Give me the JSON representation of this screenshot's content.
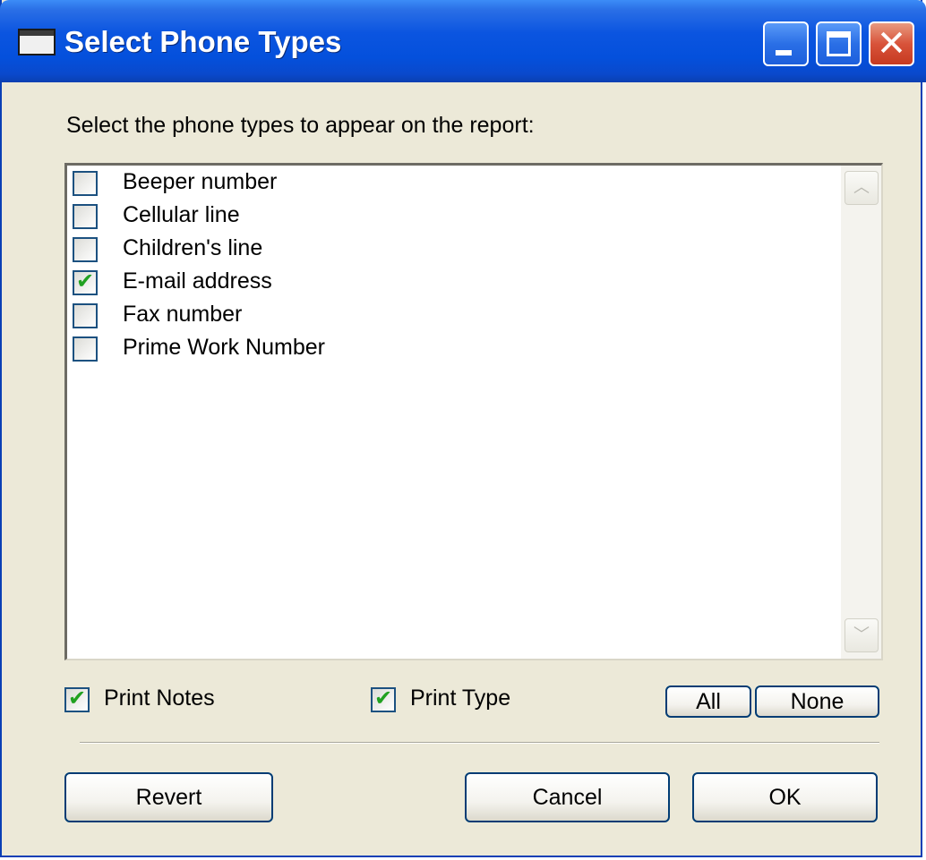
{
  "window": {
    "title": "Select Phone Types",
    "controls": [
      "minimize",
      "maximize",
      "close"
    ]
  },
  "prompt": "Select the phone types to appear on the report:",
  "phone_types": [
    {
      "label": "Beeper number",
      "checked": false
    },
    {
      "label": "Cellular line",
      "checked": false
    },
    {
      "label": "Children's line",
      "checked": false
    },
    {
      "label": "E-mail address",
      "checked": true
    },
    {
      "label": "Fax number",
      "checked": false
    },
    {
      "label": "Prime Work Number",
      "checked": false
    }
  ],
  "options": {
    "print_notes": {
      "label": "Print Notes",
      "checked": true
    },
    "print_type": {
      "label": "Print Type",
      "checked": true
    }
  },
  "buttons": {
    "all": "All",
    "none": "None",
    "revert": "Revert",
    "cancel": "Cancel",
    "ok": "OK"
  },
  "colors": {
    "dialog_bg": "#ece9d8",
    "titlebar": "#0450dc",
    "check_mark": "#21a121",
    "button_border": "#003c74"
  },
  "icons": {
    "window": "window-icon",
    "minimize": "minimize-icon",
    "maximize": "maximize-icon",
    "close": "close-icon",
    "scroll_up": "chevron-up-icon",
    "scroll_down": "chevron-down-icon",
    "check": "check-icon"
  }
}
